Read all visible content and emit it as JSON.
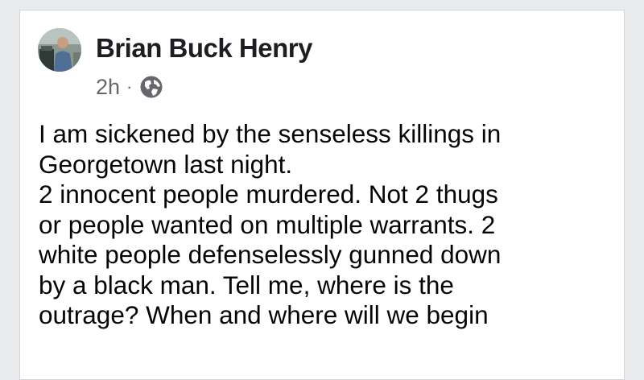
{
  "post": {
    "author": "Brian Buck Henry",
    "timestamp": "2h",
    "separator": "·",
    "privacy_icon": "globe-icon",
    "avatar_icon": "profile-photo",
    "text_lines": [
      "I am sickened by the senseless killings in",
      "Georgetown last night.",
      "2 innocent people murdered. Not 2 thugs",
      "or people wanted on multiple warrants. 2",
      "white people defenselessly gunned down",
      "by a black man. Tell me, where is the",
      "outrage?  When and where will we begin"
    ]
  },
  "colors": {
    "name": "#1c1e21",
    "meta": "#65676b",
    "body_text": "#050505",
    "card_background": "#ffffff",
    "card_border": "#d3d5d8"
  }
}
